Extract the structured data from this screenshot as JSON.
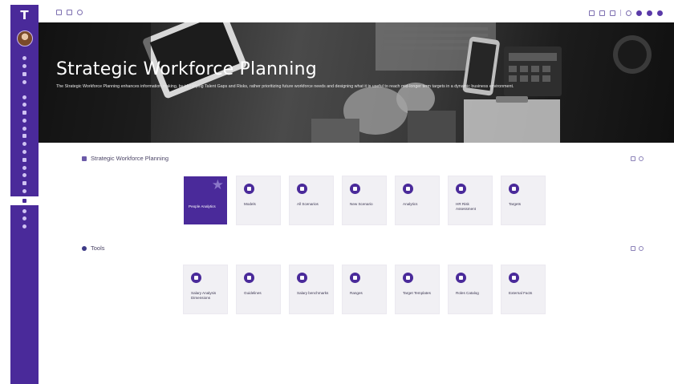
{
  "app": {
    "logo_letter": "T"
  },
  "hero": {
    "title": "Strategic Workforce Planning",
    "description": "The Strategic Workforce Planning enhances information making, by identifying Talent Gaps and Risks, rather prioritizing future workforce needs and designing what it is useful to reach mid-longer term targets in a dynamic business environment."
  },
  "sections": {
    "planning": {
      "title": "Strategic Workforce Planning",
      "tiles": [
        {
          "label": "People Analytics"
        },
        {
          "label": "Models"
        },
        {
          "label": "All Scenarios"
        },
        {
          "label": "New Scenario"
        },
        {
          "label": "Analytics"
        },
        {
          "label": "HR Risk Assessment"
        },
        {
          "label": "Targets"
        }
      ]
    },
    "tools": {
      "title": "Tools",
      "tiles": [
        {
          "label": "Salary Analysis Dimensions"
        },
        {
          "label": "Guidelines"
        },
        {
          "label": "Salary benchmarks"
        },
        {
          "label": "Ranges"
        },
        {
          "label": "Target Templates"
        },
        {
          "label": "Roles Catalog"
        },
        {
          "label": "External Facts"
        }
      ]
    }
  },
  "colors": {
    "accent": "#4a2a9a",
    "tile_bg": "#f1f0f4"
  }
}
